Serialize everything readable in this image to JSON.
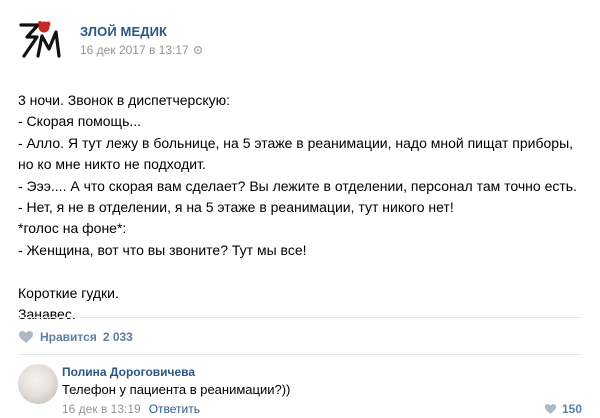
{
  "post": {
    "author": "ЗЛОЙ МЕДИК",
    "date": "16 дек 2017 в 13:17",
    "text": "3 ночи. Звонок в диспетчерскую:\n- Скорая помощь...\n- Алло. Я тут лежу в больнице, на 5 этаже в реанимации, надо мной пищат приборы,\nно ко мне никто не подходит.\n- Эээ.... А что скорая вам сделает? Вы лежите в отделении, персонал там точно есть.\n- Нет, я не в отделении, я на 5 этаже в реанимации, тут никого нет!\n*голос на фоне*:\n- Женщина, вот что вы звоните? Тут мы все!\n\nКороткие гудки.\nЗанавес.",
    "likes_label": "Нравится",
    "likes_count": "2 033",
    "logo_letters": "ЗМ",
    "logo_color": "#c62828"
  },
  "comment": {
    "author": "Полина Дороговичева",
    "text": "Телефон у пациента в реанимации?))",
    "date": "16 дек в 13:19",
    "reply_label": "Ответить",
    "likes_count": "150"
  },
  "colors": {
    "link": "#2a5885",
    "meta": "#939393",
    "like": "#5b7fa6",
    "divider": "#e7e8ec"
  },
  "icons": [
    "logo-icon",
    "gear-icon",
    "heart-icon"
  ]
}
